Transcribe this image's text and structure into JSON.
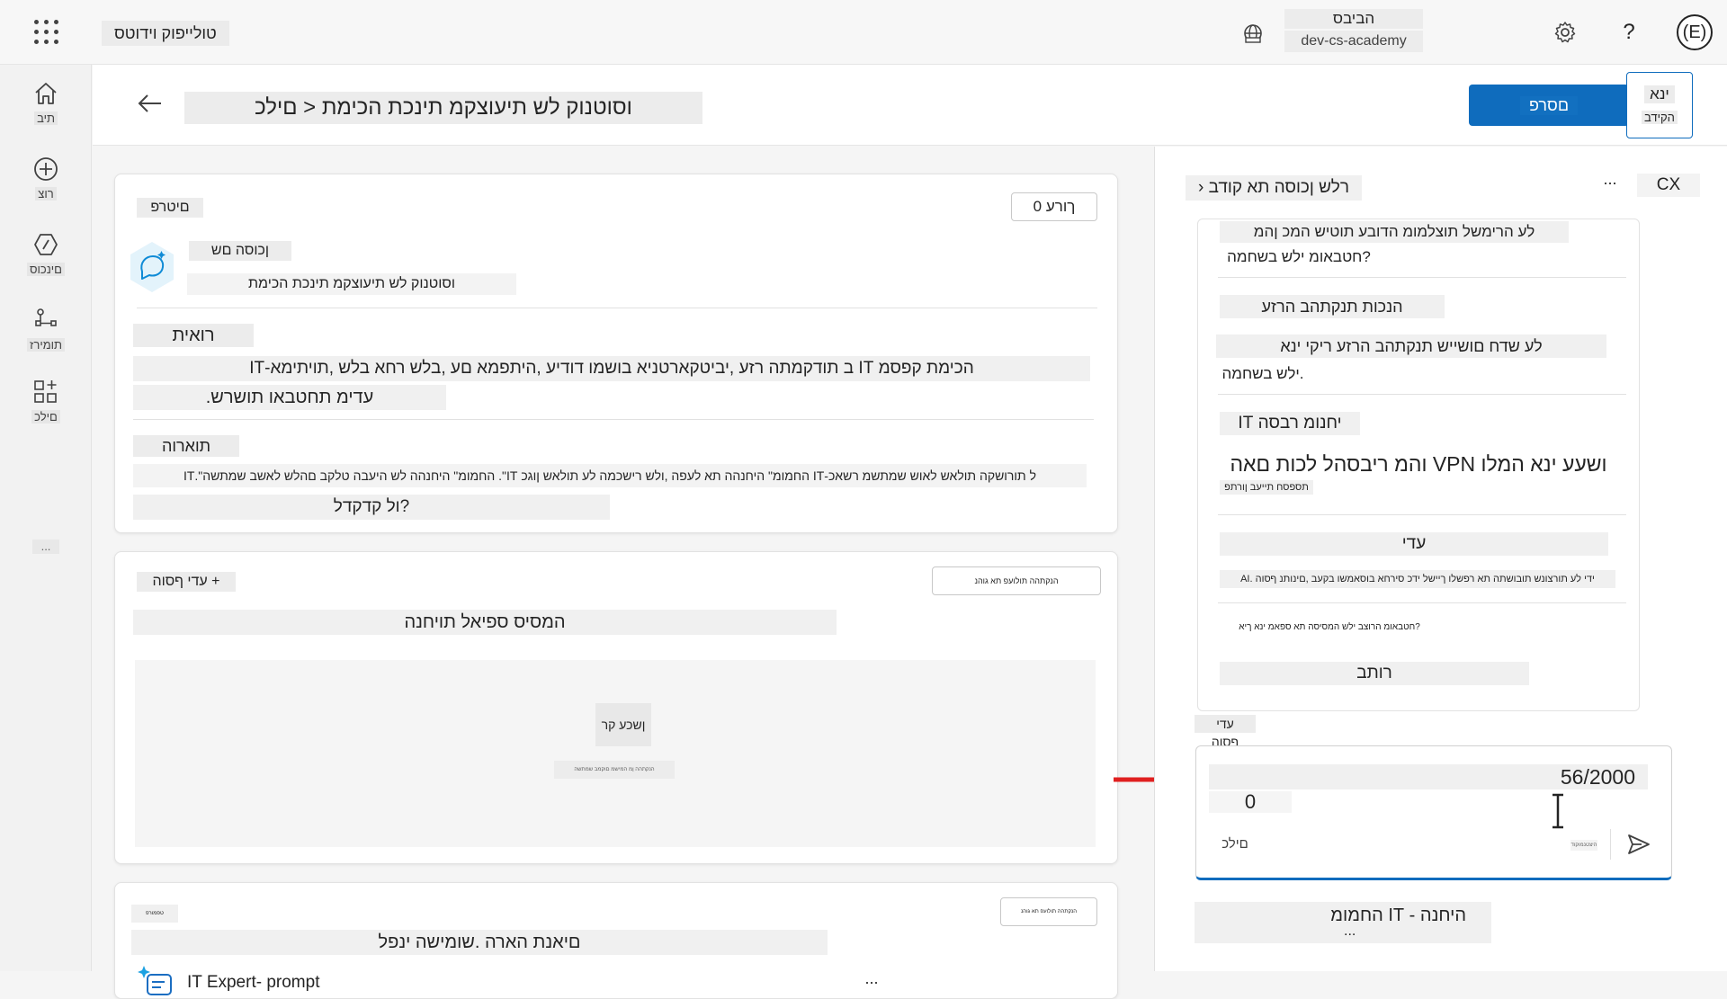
{
  "topbar": {
    "app_name": "טולייפוק וידוטס",
    "environment_name": "הביבס",
    "environment_id": "dev-cs-academy",
    "avatar_initial": "(E)",
    "help_glyph": "?",
    "icons": [
      "app-launcher-icon",
      "environment-globe-icon",
      "settings-gear-icon"
    ]
  },
  "rail": {
    "items": [
      {
        "label": "תיב",
        "icon": "home-icon"
      },
      {
        "label": "רוצ",
        "icon": "create-plus-icon"
      },
      {
        "label": "םינכוס",
        "icon": "agents-icon"
      },
      {
        "label": "תומירז",
        "icon": "flows-icon"
      },
      {
        "label": "םילכ",
        "icon": "tools-icon"
      }
    ],
    "more_label": "..."
  },
  "header": {
    "breadcrumb": "וסוטנוק לש תיעוצקמ תינכת הכימת < םילכ",
    "publish_label": "םסרפ",
    "test_label_top": "ינא",
    "test_label_bottom": "הקידב"
  },
  "details_card": {
    "badge_label": "םיטרפ",
    "edit_label": "ךורע 0",
    "name_label": "ןכוסה םש",
    "name_value": "וסוטנוק לש תיעוצקמ תינכת הכימת",
    "description_title": "רואית",
    "description_line1": "הכימת קפסמ IT ב תודקמתה רזע ,יביטקארטניא בושמו דודיע ,היתפמא םע ,בלש רחא בלש ,תויתימא-IT",
    "description_line2": "עדימ תחטבאו תושרש.",
    "instructions_title": "תוארוה",
    "instructions_line1": "ל תורושקה תולאש לאוש שמתשמ רשאכ-IT החמומ\" היחנהה תא לעפה ,ולש רישכמה לע תולאש ןוגכ IT\". החמומ\" היחנהה לש היעבה טלקב םהלש לאשב שמתשה\".IT",
    "instructions_line2": "?ול קדקדל"
  },
  "prompt_card": {
    "add_input_label": "+ עדי ףסוה",
    "top_pill_label": "הנקתהה תולועפ תא גוהנ",
    "heading": "המסיס ספיאל תויחנה",
    "empty_label": "ןשכע קר",
    "empty_sub": "הנקתהה ןמ המישמ םוקמב שמתשה"
  },
  "third_card": {
    "small_label": "טפמורפ",
    "top_pill_label": "הנקתהה תולועפ תא גוהנ",
    "heading": "םיאנת הארה .שומישה ינפל",
    "tool_name": "IT Expert- prompt",
    "more_label": "..."
  },
  "test_panel": {
    "title": "רלש ןכוסה תא קודב ‹",
    "more_label": "...",
    "close_label": "CX",
    "messages": [
      {
        "line1": "לע הרימשל תוצלמומ הדובע תוטיש המכ ןהמ",
        "line2": "?חטבאומ ילש בשחמה"
      },
      {
        "line1": "הנכות תנקתהב הרזע"
      },
      {
        "line1": "לע שדח םושייש תנקתהב הרזע ריקי ינא",
        "line2": ".ילש בשחמה"
      },
      {
        "line1": "יחנומ רבסה IT"
      },
      {
        "line1": "ושעע ינא המלו VPN והמ ריבסהל לכות םאה",
        "line2": "תספסח תייעב ןורתפ"
      },
      {
        "line1": "עדי"
      },
      {
        "line1": "ידי לע תורצונש תובושתה תא רפשלו ךיישל ידכ סירחא בוסאמשו בקעב ,םינותנ ףסוה .AI"
      },
      {
        "line1": "?חטבאומ הרוצב ילש המסיסה תא ספאמ ינא ךיא"
      },
      {
        "line1": "רותב"
      }
    ],
    "add_knowledge_label": "עדי ףסוה",
    "char_count": "56/2000",
    "input_value": "0",
    "tools_label": "םילכ",
    "small_status": "היצטנמוקוד",
    "footer_title": "היחנה - IT החמומ",
    "footer_more": "..."
  },
  "colors": {
    "accent": "#0f6cbd",
    "annotation_arrow": "#e02020"
  }
}
